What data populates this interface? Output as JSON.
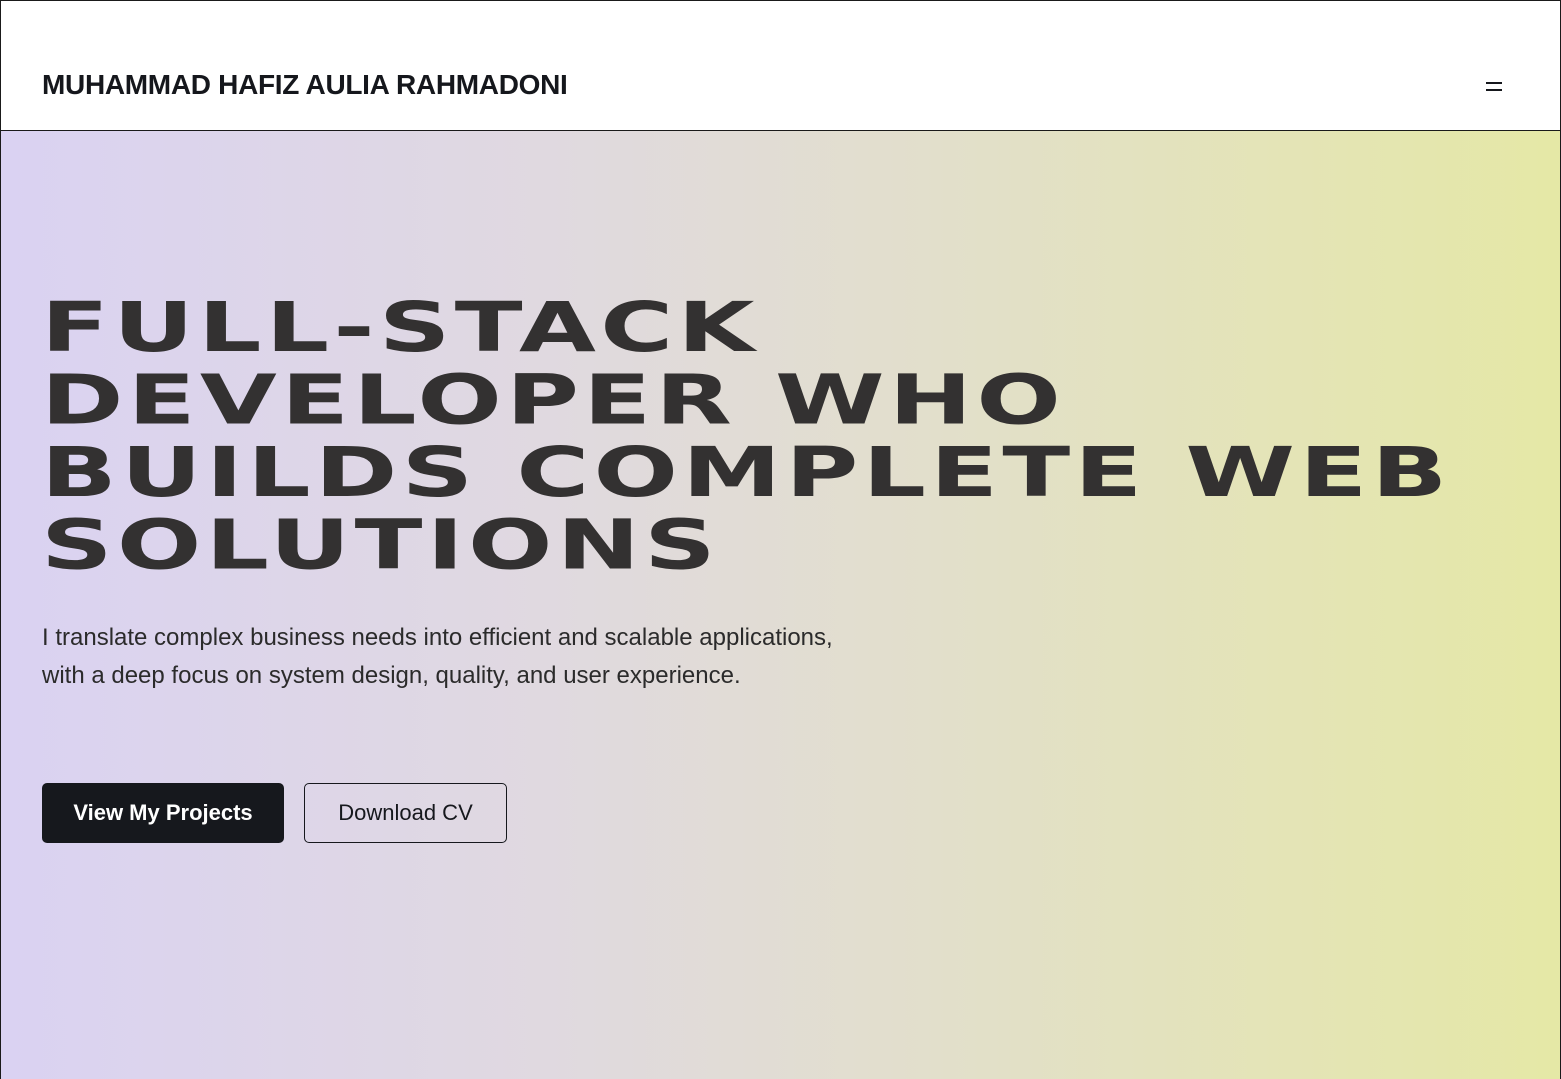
{
  "header": {
    "brand": "MUHAMMAD HAFIZ AULIA RAHMADONI",
    "menu_icon": "hamburger-menu-icon"
  },
  "hero": {
    "headline_lines": [
      "FULL-STACK",
      "DEVELOPER WHO",
      "BUILDS COMPLETE WEB",
      "SOLUTIONS"
    ],
    "subtitle": "I translate complex business needs into efficient and scalable applications, with a deep focus on system design, quality, and user experience.",
    "primary_button": "View My Projects",
    "secondary_button": "Download CV"
  },
  "colors": {
    "text_dark": "#16181d",
    "headline": "#333131",
    "gradient_start": "#dad2f2",
    "gradient_end": "#e5e8a6"
  }
}
